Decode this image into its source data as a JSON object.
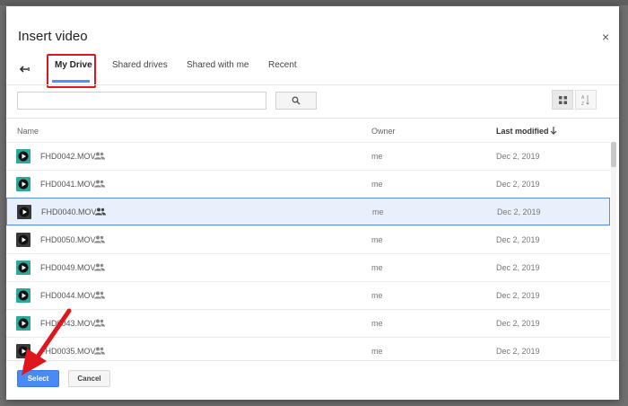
{
  "dialog": {
    "title": "Insert video",
    "close_label": "×"
  },
  "tabs": [
    {
      "label": "My Drive",
      "active": true
    },
    {
      "label": "Shared drives",
      "active": false
    },
    {
      "label": "Shared with me",
      "active": false
    },
    {
      "label": "Recent",
      "active": false
    }
  ],
  "search": {
    "placeholder": "",
    "value": ""
  },
  "columns": {
    "name": "Name",
    "owner": "Owner",
    "last_modified": "Last modified"
  },
  "files": [
    {
      "name": "FHD0042.MOV",
      "owner": "me",
      "modified": "Dec 2, 2019",
      "selected": false
    },
    {
      "name": "FHD0041.MOV",
      "owner": "me",
      "modified": "Dec 2, 2019",
      "selected": false
    },
    {
      "name": "FHD0040.MOV",
      "owner": "me",
      "modified": "Dec 2, 2019",
      "selected": true
    },
    {
      "name": "FHD0050.MOV",
      "owner": "me",
      "modified": "Dec 2, 2019",
      "selected": false
    },
    {
      "name": "FHD0049.MOV",
      "owner": "me",
      "modified": "Dec 2, 2019",
      "selected": false
    },
    {
      "name": "FHD0044.MOV",
      "owner": "me",
      "modified": "Dec 2, 2019",
      "selected": false
    },
    {
      "name": "FHD0043.MOV",
      "owner": "me",
      "modified": "Dec 2, 2019",
      "selected": false
    },
    {
      "name": "FHD0035.MOV",
      "owner": "me",
      "modified": "Dec 2, 2019",
      "selected": false
    }
  ],
  "footer": {
    "select_label": "Select",
    "cancel_label": "Cancel"
  },
  "colors": {
    "accent": "#4a8af4",
    "highlight": "#e0161c",
    "selected_row": "#e8f0fb",
    "thumb_teal": "#2fa89c"
  },
  "icons": {
    "back": "arrow-left-icon",
    "close": "close-icon",
    "search": "search-icon",
    "grid_view": "grid-view-icon",
    "sort": "sort-az-icon",
    "sort_direction": "arrow-down-icon",
    "file_thumb": "video-file-icon",
    "shared": "people-icon"
  }
}
